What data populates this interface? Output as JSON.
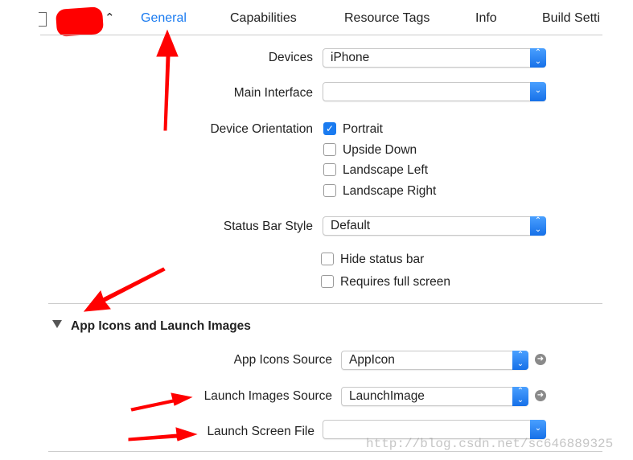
{
  "tabs": [
    {
      "label": "General",
      "active": true
    },
    {
      "label": "Capabilities"
    },
    {
      "label": "Resource Tags"
    },
    {
      "label": "Info"
    },
    {
      "label": "Build Setti"
    }
  ],
  "deployment": {
    "devices_label": "Devices",
    "devices_value": "iPhone",
    "main_interface_label": "Main Interface",
    "main_interface_value": "",
    "orientation_label": "Device Orientation",
    "orientations": [
      {
        "label": "Portrait",
        "checked": true
      },
      {
        "label": "Upside Down",
        "checked": false
      },
      {
        "label": "Landscape Left",
        "checked": false
      },
      {
        "label": "Landscape Right",
        "checked": false
      }
    ],
    "status_bar_label": "Status Bar Style",
    "status_bar_value": "Default",
    "hide_status_bar": {
      "label": "Hide status bar",
      "checked": false
    },
    "requires_full_screen": {
      "label": "Requires full screen",
      "checked": false
    }
  },
  "app_icons": {
    "section_title": "App Icons and Launch Images",
    "icons_source_label": "App Icons Source",
    "icons_source_value": "AppIcon",
    "launch_images_label": "Launch Images Source",
    "launch_images_value": "LaunchImage",
    "launch_screen_label": "Launch Screen File",
    "launch_screen_value": ""
  },
  "watermark": "http://blog.csdn.net/sc646889325",
  "colors": {
    "accent": "#1a7bf0",
    "annotation": "#ff0000"
  }
}
